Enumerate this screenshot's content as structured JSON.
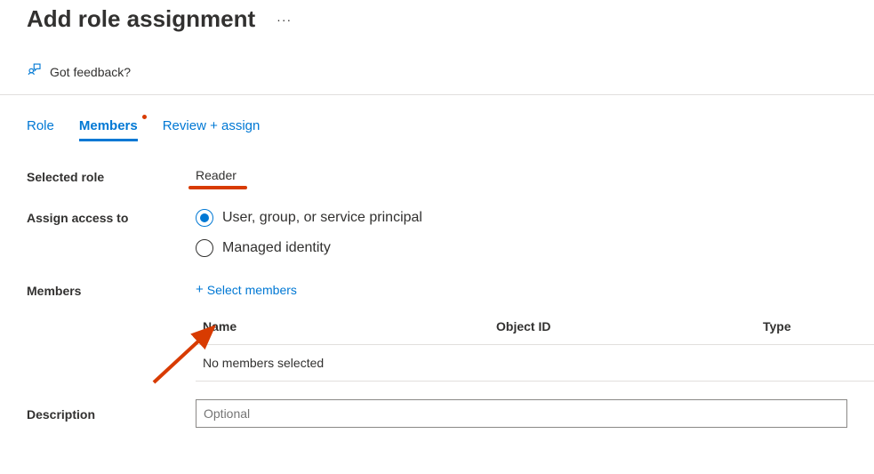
{
  "header": {
    "title": "Add role assignment"
  },
  "feedback": {
    "text": "Got feedback?"
  },
  "tabs": [
    {
      "label": "Role",
      "active": false
    },
    {
      "label": "Members",
      "active": true
    },
    {
      "label": "Review + assign",
      "active": false
    }
  ],
  "form": {
    "selected_role_label": "Selected role",
    "selected_role_value": "Reader",
    "assign_access_label": "Assign access to",
    "assign_options": [
      {
        "label": "User, group, or service principal",
        "selected": true
      },
      {
        "label": "Managed identity",
        "selected": false
      }
    ],
    "members_label": "Members",
    "select_members_link": "Select members",
    "table": {
      "headers": {
        "name": "Name",
        "object_id": "Object ID",
        "type": "Type"
      },
      "empty_text": "No members selected"
    },
    "description_label": "Description",
    "description_placeholder": "Optional"
  }
}
